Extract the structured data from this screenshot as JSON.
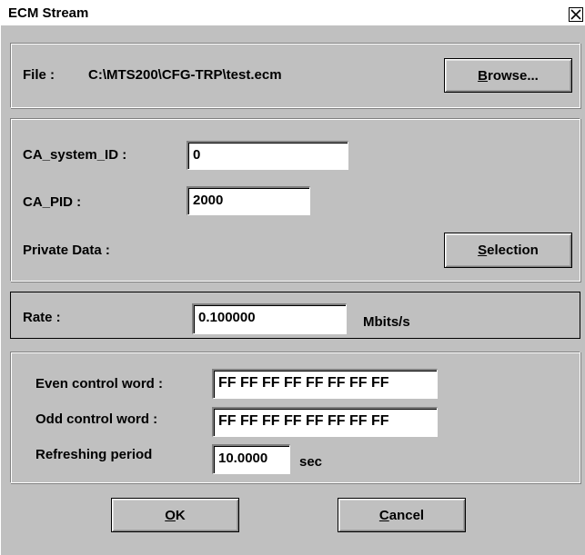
{
  "window": {
    "title": "ECM Stream"
  },
  "file": {
    "label": "File :",
    "path": "C:\\MTS200\\CFG-TRP\\test.ecm",
    "browse_first": "B",
    "browse_rest": "rowse..."
  },
  "ca": {
    "system_id_label": "CA_system_ID :",
    "system_id_value": "0",
    "pid_label": "CA_PID :",
    "pid_value": "2000",
    "private_data_label": "Private Data :",
    "selection_first": "S",
    "selection_rest": "election"
  },
  "rate": {
    "label": "Rate :",
    "value": "0.100000",
    "unit": "Mbits/s"
  },
  "control": {
    "even_label": "Even control word :",
    "even_value": "FF FF FF FF FF FF FF FF",
    "odd_label": "Odd control word :",
    "odd_value": "FF FF FF FF FF FF FF FF",
    "period_label": "Refreshing period",
    "period_value": "10.0000",
    "period_unit": "sec"
  },
  "buttons": {
    "ok_first": "O",
    "ok_rest": "K",
    "cancel_first": "C",
    "cancel_rest": "ancel"
  }
}
